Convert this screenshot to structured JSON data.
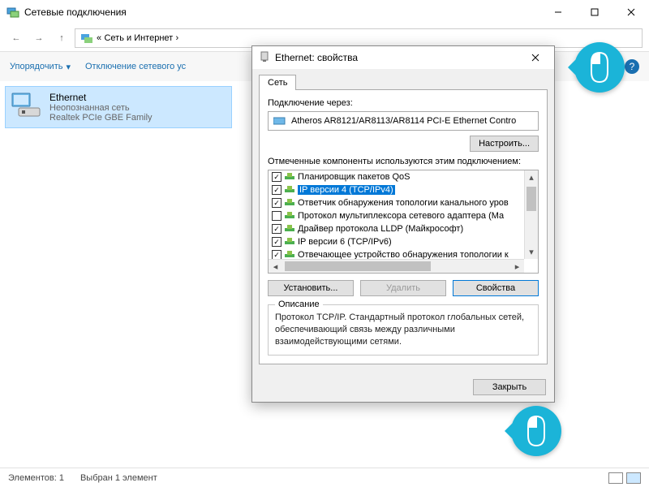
{
  "window": {
    "title": "Сетевые подключения",
    "breadcrumb_prefix": "«",
    "breadcrumb_a": "Сеть и Интернет",
    "breadcrumb_sep": "›"
  },
  "toolbar": {
    "organize": "Упорядочить",
    "disable": "Отключение сетевого ус"
  },
  "connection": {
    "name": "Ethernet",
    "status": "Неопознанная сеть",
    "adapter": "Realtek PCIe GBE Family"
  },
  "statusbar": {
    "count": "Элементов: 1",
    "selected": "Выбран 1 элемент"
  },
  "dialog": {
    "title": "Ethernet: свойства",
    "tab_network": "Сеть",
    "connect_via_label": "Подключение через:",
    "adapter_name": "Atheros AR8121/AR8113/AR8114 PCI-E Ethernet Contro",
    "configure_btn": "Настроить...",
    "components_label": "Отмеченные компоненты используются этим подключением:",
    "components": [
      {
        "checked": true,
        "label": "Планировщик пакетов QoS",
        "selected": false
      },
      {
        "checked": true,
        "label": "IP версии 4 (TCP/IPv4)",
        "selected": true
      },
      {
        "checked": true,
        "label": "Ответчик обнаружения топологии канального уров",
        "selected": false
      },
      {
        "checked": false,
        "label": "Протокол мультиплексора сетевого адаптера (Ма",
        "selected": false
      },
      {
        "checked": true,
        "label": "Драйвер протокола LLDP (Майкрософт)",
        "selected": false
      },
      {
        "checked": true,
        "label": "IP версии 6 (TCP/IPv6)",
        "selected": false
      },
      {
        "checked": true,
        "label": "Отвечающее устройство обнаружения топологии к",
        "selected": false
      }
    ],
    "install_btn": "Установить...",
    "remove_btn": "Удалить",
    "properties_btn": "Свойства",
    "description_legend": "Описание",
    "description_text": "Протокол TCP/IP. Стандартный протокол глобальных сетей, обеспечивающий связь между различными взаимодействующими сетями.",
    "close_btn": "Закрыть"
  }
}
